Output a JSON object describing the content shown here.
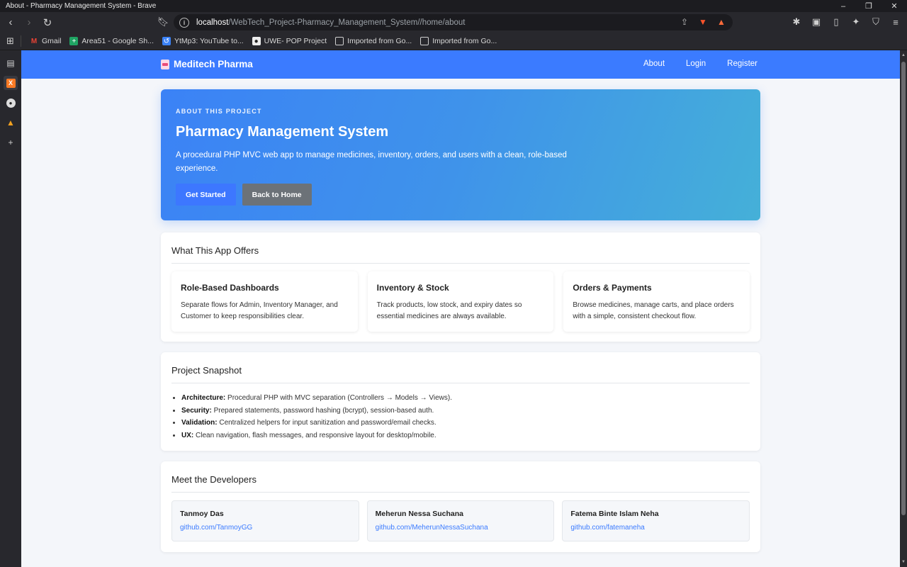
{
  "window": {
    "title": "About - Pharmacy Management System - Brave"
  },
  "address_bar": {
    "host": "localhost",
    "path": "/WebTech_Project-Pharmacy_Management_System//home/about"
  },
  "bookmarks": [
    {
      "label": "Gmail",
      "icon": "gmail-icon"
    },
    {
      "label": "Area51 - Google Sh...",
      "icon": "sheets-icon"
    },
    {
      "label": "YtMp3: YouTube to...",
      "icon": "ytmp3-icon"
    },
    {
      "label": "UWE- POP Project",
      "icon": "github-icon"
    },
    {
      "label": "Imported from Go...",
      "icon": "folder-icon"
    },
    {
      "label": "Imported from Go...",
      "icon": "folder-icon"
    }
  ],
  "site": {
    "brand": "Meditech Pharma",
    "nav": [
      "About",
      "Login",
      "Register"
    ]
  },
  "hero": {
    "eyebrow": "ABOUT THIS PROJECT",
    "title": "Pharmacy Management System",
    "description": "A procedural PHP MVC web app to manage medicines, inventory, orders, and users with a clean, role-based experience.",
    "primary_button": "Get Started",
    "secondary_button": "Back to Home"
  },
  "offers": {
    "heading": "What This App Offers",
    "items": [
      {
        "title": "Role-Based Dashboards",
        "text": "Separate flows for Admin, Inventory Manager, and Customer to keep responsibilities clear."
      },
      {
        "title": "Inventory & Stock",
        "text": "Track products, low stock, and expiry dates so essential medicines are always available."
      },
      {
        "title": "Orders & Payments",
        "text": "Browse medicines, manage carts, and place orders with a simple, consistent checkout flow."
      }
    ]
  },
  "snapshot": {
    "heading": "Project Snapshot",
    "items": [
      {
        "label": "Architecture:",
        "text": " Procedural PHP with MVC separation (Controllers → Models → Views)."
      },
      {
        "label": "Security:",
        "text": " Prepared statements, password hashing (bcrypt), session-based auth."
      },
      {
        "label": "Validation:",
        "text": " Centralized helpers for input sanitization and password/email checks."
      },
      {
        "label": "UX:",
        "text": " Clean navigation, flash messages, and responsive layout for desktop/mobile."
      }
    ]
  },
  "developers": {
    "heading": "Meet the Developers",
    "items": [
      {
        "name": "Tanmoy Das",
        "link": "github.com/TanmoyGG"
      },
      {
        "name": "Meherun Nessa Suchana",
        "link": "github.com/MeherunNessaSuchana"
      },
      {
        "name": "Fatema Binte Islam Neha",
        "link": "github.com/fatemaneha"
      }
    ]
  }
}
